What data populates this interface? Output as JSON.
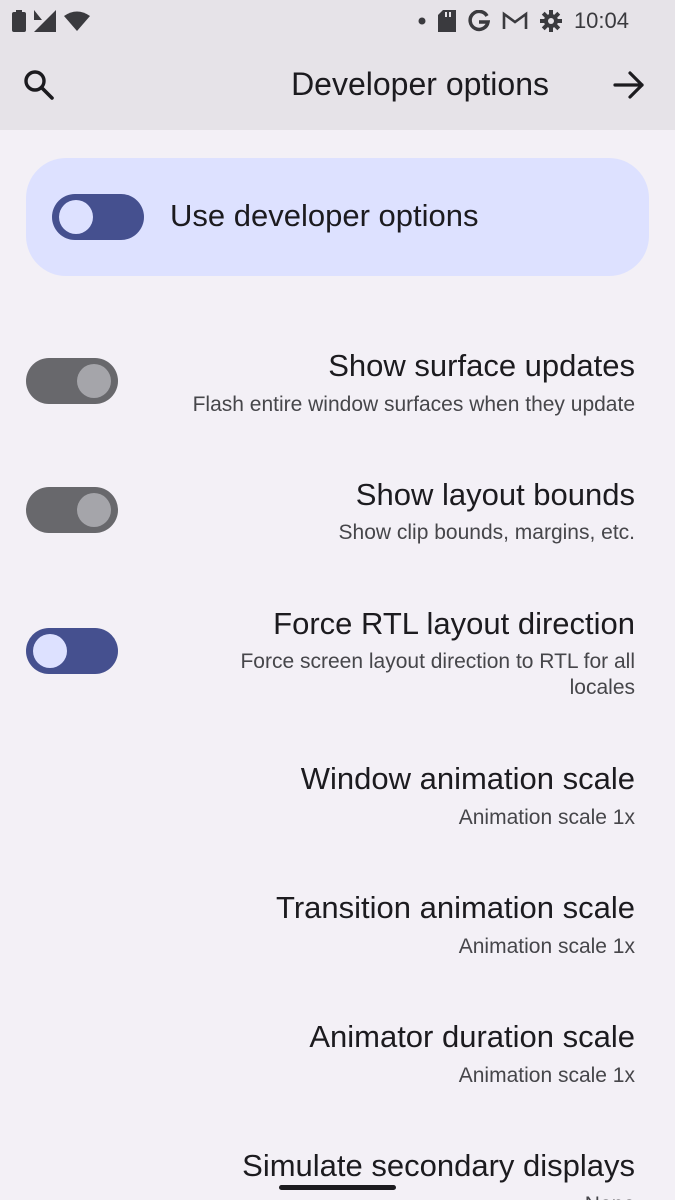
{
  "status_bar": {
    "time": "10:04",
    "left_icons": [
      "battery-icon",
      "signal-icon",
      "wifi-icon"
    ],
    "right_icons": [
      "dot-icon",
      "sd-card-icon",
      "google-icon",
      "gmail-icon",
      "settings-gear-icon"
    ]
  },
  "app_bar": {
    "title": "Developer options",
    "search_icon": "search-icon",
    "back_icon": "arrow-right-icon"
  },
  "main_switch": {
    "label": "Use developer options",
    "checked": true
  },
  "settings": [
    {
      "title": "Show surface updates",
      "subtitle": "Flash entire window surfaces when they update",
      "switch": "off"
    },
    {
      "title": "Show layout bounds",
      "subtitle": "Show clip bounds, margins, etc.",
      "switch": "off"
    },
    {
      "title": "Force RTL layout direction",
      "subtitle_line1": "Force screen layout direction to RTL for all",
      "subtitle_line2": "locales",
      "switch": "on"
    },
    {
      "title": "Window animation scale",
      "subtitle": "Animation scale 1x"
    },
    {
      "title": "Transition animation scale",
      "subtitle": "Animation scale 1x"
    },
    {
      "title": "Animator duration scale",
      "subtitle": "Animation scale 1x"
    },
    {
      "title": "Simulate secondary displays",
      "subtitle": "None"
    }
  ],
  "colors": {
    "background": "#f3f0f6",
    "appbar": "#e6e3e8",
    "card": "#dde1ff",
    "switch_on_track": "#45508f",
    "switch_off_track": "#68686c"
  }
}
